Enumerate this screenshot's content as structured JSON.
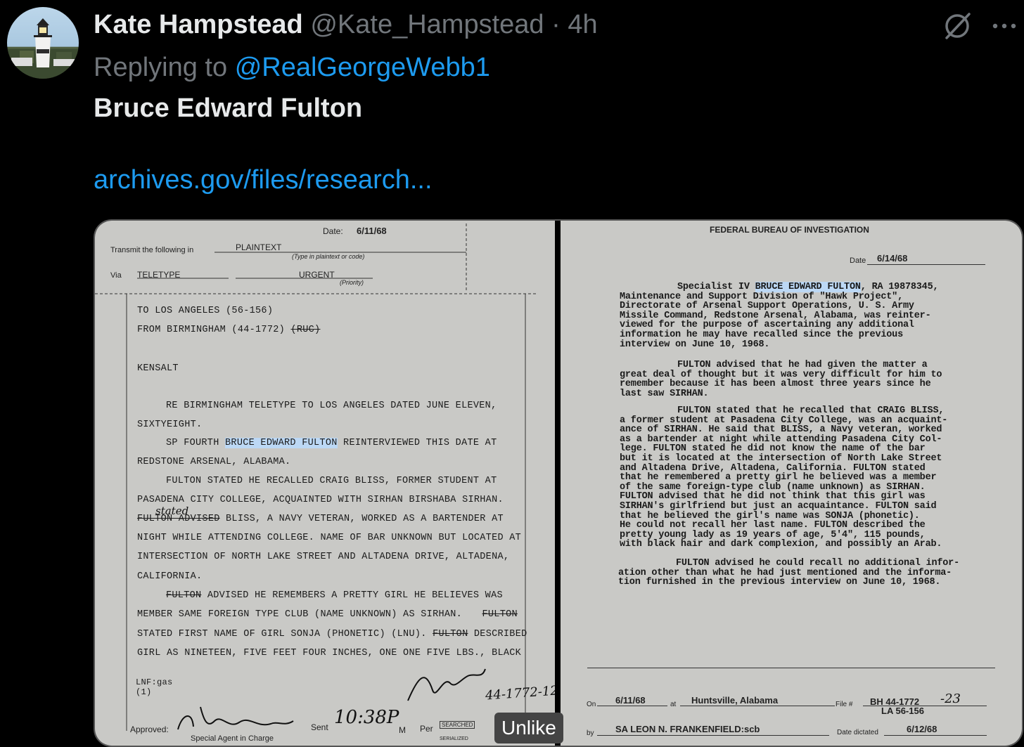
{
  "tweet": {
    "author_name": "Kate Hampstead",
    "author_handle": "@Kate_Hampstead",
    "separator": "·",
    "time": "4h",
    "replying_prefix": "Replying to",
    "replying_to": "@RealGeorgeWebb1",
    "text": "Bruce Edward Fulton",
    "link": "archives.gov/files/research..."
  },
  "icons": {
    "avatar": "lighthouse-avatar",
    "grok": "grok-slash-icon",
    "more": "more-ellipsis-icon"
  },
  "tooltip": "Unlike",
  "doc_left": {
    "date_label": "Date:",
    "date": "6/11/68",
    "transmit_label": "Transmit the following in",
    "transmit_value": "PLAINTEXT",
    "transmit_hint": "(Type in plaintext or code)",
    "via_label": "Via",
    "via_value": "TELETYPE",
    "priority_value": "URGENT",
    "priority_hint": "(Priority)",
    "lines": {
      "to": "TO  LOS ANGELES (56-156)",
      "from": "FROM  BIRMINGHAM (44-1772)",
      "from_struck": "(RUC)",
      "kensalt": "KENSALT",
      "re1": "RE  BIRMINGHAM TELETYPE TO LOS ANGELES DATED JUNE ELEVEN,",
      "re2": "SIXTYEIGHT.",
      "sp_pre": "SP FOURTH ",
      "sp_name": "BRUCE EDWARD FULTON",
      "sp_post": " REINTERVIEWED THIS DATE AT",
      "l4": "REDSTONE ARSENAL, ALABAMA.",
      "l5": "FULTON STATED HE RECALLED CRAIG BLISS, FORMER STUDENT AT",
      "l6": "PASADENA CITY COLLEGE, ACQUAINTED WITH SIRHAN BIRSHABA SIRHAN.",
      "l7_struck": "FULTON ADVISED",
      "l7": " BLISS, A NAVY VETERAN, WORKED AS A BARTENDER AT",
      "l7_note": "stated",
      "l8": "NIGHT WHILE ATTENDING COLLEGE.  NAME OF BAR UNKNOWN BUT LOCATED AT",
      "l9": "INTERSECTION OF NORTH LAKE STREET AND ALTADENA DRIVE, ALTADENA,",
      "l10": "CALIFORNIA.",
      "l11_struck": "FULTON",
      "l11": " ADVISED HE REMEMBERS A PRETTY GIRL HE BELIEVES WAS",
      "l12": "MEMBER SAME FOREIGN TYPE CLUB (NAME UNKNOWN) AS SIRHAN.",
      "l12_struck": "FULTON",
      "l13": "STATED FIRST NAME OF GIRL SONJA (PHONETIC) (LNU).",
      "l13_struck": "FULTON",
      "l13_post": " DESCRIBED",
      "l14": "GIRL AS NINETEEN, FIVE FEET FOUR INCHES, ONE ONE FIVE LBS., BLACK",
      "lnf": "LNF:gas",
      "lnf2": "(1)"
    },
    "handwritten_file": "44-1772-12",
    "handwritten_time": "10:38P",
    "approved_label": "Approved:",
    "sent_label": "Sent",
    "sent_m": "M",
    "per_label": "Per",
    "sac_label": "Special Agent in Charge",
    "stamp": "SEARCHED",
    "stamp2": "SERIALIZED"
  },
  "doc_right": {
    "header": "FEDERAL BUREAU OF INVESTIGATION",
    "date_label": "Date",
    "date": "6/14/68",
    "p1": [
      {
        "pre": "Specialist IV ",
        "hl": "BRUCE EDWARD FULTON",
        "post": ", RA 19878345,"
      },
      {
        "pre": "Maintenance and Support Division of \"Hawk Project\","
      },
      {
        "pre": "Directorate of Arsenal Support Operations, U. S. Army"
      },
      {
        "pre": "Missile Command, Redstone Arsenal, Alabama, was reinter-"
      },
      {
        "pre": "viewed for the purpose of ascertaining any additional"
      },
      {
        "pre": "information he may have recalled since the previous"
      },
      {
        "pre": "interview on June 10, 1968."
      }
    ],
    "p2": [
      "FULTON advised that he had given the matter a",
      "great deal of thought but it was very difficult for him to",
      "remember because it has been almost three years since he",
      "last saw SIRHAN."
    ],
    "p3": [
      "FULTON stated that he recalled that CRAIG BLISS,",
      "a former student at Pasadena City College, was an acquaint-",
      "ance of SIRHAN.  He said that BLISS, a Navy veteran, worked",
      "as a bartender at night while attending Pasadena City Col-",
      "lege.  FULTON stated he did not know the name of the bar",
      "but it is located at the intersection of North Lake Street",
      "and Altadena Drive, Altadena, California.  FULTON stated",
      "that he remembered a pretty girl he believed was a member",
      "of the same foreign-type club (name unknown) as SIRHAN.",
      "FULTON advised that he did not think that this girl was",
      "SIRHAN's girlfriend but just an acquaintance.  FULTON said",
      "that he believed the girl's name was SONJA (phonetic).",
      "He could not recall her last name.  FULTON described the",
      "pretty young lady as 19 years of age, 5'4\", 115 pounds,",
      "with black hair and dark complexion, and possibly an Arab."
    ],
    "p4": [
      "FULTON advised he could recall no additional infor-",
      "ation other than what he had just mentioned and the informa-",
      "tion furnished in the previous interview on June 10, 1968."
    ],
    "on_label": "On",
    "on_date": "6/11/68",
    "at_label": "at",
    "at_place": "Huntsville, Alabama",
    "file_label": "File #",
    "file1": "BH 44-1772",
    "file_hand": "-23",
    "file2": "LA 56-156",
    "by_label": "by",
    "by_agent": "SA LEON N. FRANKENFIELD:scb",
    "dictated_label": "Date dictated",
    "dictated": "6/12/68"
  }
}
